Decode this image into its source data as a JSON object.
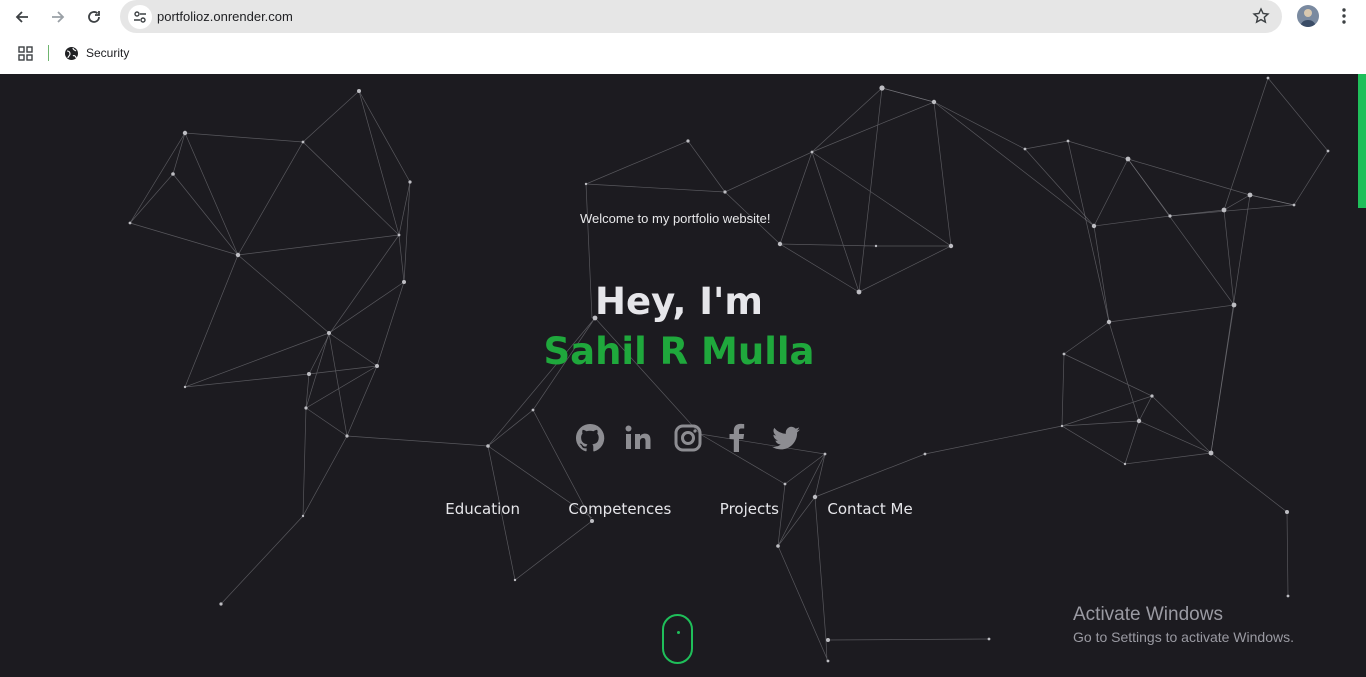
{
  "browser": {
    "url": "portfolioz.onrender.com",
    "bookmarks": [
      {
        "label": "Security",
        "icon": "globe-icon"
      }
    ]
  },
  "hero": {
    "welcome": "Welcome to my portfolio website!",
    "greeting": "Hey, I'm",
    "name": "Sahil R Mulla",
    "accent_color": "#1fa83c",
    "socials": [
      "github-icon",
      "linkedin-icon",
      "instagram-icon",
      "facebook-icon",
      "twitter-icon"
    ]
  },
  "nav": {
    "links": [
      "Education",
      "Competences",
      "Projects",
      "Contact Me"
    ]
  },
  "watermark": {
    "title": "Activate Windows",
    "subtitle": "Go to Settings to activate Windows."
  }
}
